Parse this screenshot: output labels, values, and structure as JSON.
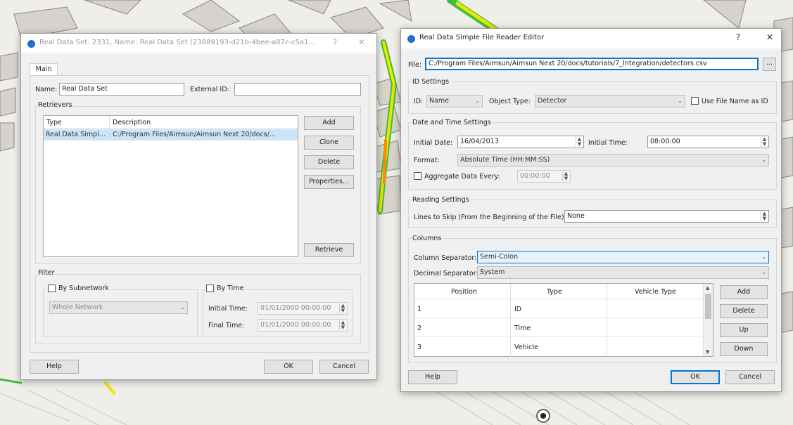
{
  "colors": {
    "accent": "#0078d7",
    "title_dot": "#1e6fd0",
    "map_bg": "#efeee9",
    "map_green": "#3cbf3c",
    "map_yellow": "#f3e300",
    "map_orange": "#ff8a00"
  },
  "real_data_set_dialog": {
    "title": "Real Data Set: 2331, Name: Real Data Set (23889193-d21b-4bee-a87c-c5a1...",
    "help_glyph": "?",
    "close_glyph": "✕",
    "tab_main": "Main",
    "name_label": "Name:",
    "name_value": "Real Data Set",
    "external_id_label": "External ID:",
    "external_id_value": "",
    "retrievers_group": "Retrievers",
    "columns": [
      "Type",
      "Description"
    ],
    "rows": [
      {
        "type": "Real Data Simpl...",
        "description": "C:/Program Files/Aimsun/Aimsun Next 20/docs/..."
      }
    ],
    "buttons": {
      "add": "Add",
      "clone": "Clone",
      "delete": "Delete",
      "properties": "Properties...",
      "retrieve": "Retrieve"
    },
    "filter_group": "Filter",
    "by_subnetwork": "By Subnetwork",
    "subnetwork_value": "Whole Network",
    "by_time": "By Time",
    "initial_time_label": "Initial Time:",
    "initial_time_value": "01/01/2000 00:00:00",
    "final_time_label": "Final Time:",
    "final_time_value": "01/01/2000 00:00:00",
    "help": "Help",
    "ok": "OK",
    "cancel": "Cancel"
  },
  "reader_editor_dialog": {
    "title": "Real Data Simple File Reader Editor",
    "help_glyph": "?",
    "close_glyph": "✕",
    "file_label": "File:",
    "file_value": "C:/Program Files/Aimsun/Aimsun Next 20/docs/tutorials/7_Integration/detectors.csv",
    "browse": "...",
    "id_settings": "ID Settings",
    "id_label": "ID:",
    "id_value": "Name",
    "object_type_label": "Object Type:",
    "object_type_value": "Detector",
    "use_file_name": "Use File Name as ID",
    "date_time_settings": "Date and Time Settings",
    "initial_date_label": "Initial Date:",
    "initial_date_value": "16/04/2013",
    "initial_time_label": "Initial Time:",
    "initial_time_value": "08:00:00",
    "format_label": "Format:",
    "format_value": "Absolute Time (HH:MM:SS)",
    "aggregate_label": "Aggregate Data Every:",
    "aggregate_value": "00:00:00",
    "reading_settings": "Reading Settings",
    "lines_to_skip_label": "Lines to Skip (From the Beginning of the File):",
    "lines_to_skip_value": "None",
    "columns_group": "Columns",
    "column_separator_label": "Column Separator:",
    "column_separator_value": "Semi-Colon",
    "decimal_separator_label": "Decimal Separator:",
    "decimal_separator_value": "System",
    "table_headers": [
      "Position",
      "Type",
      "Vehicle Type"
    ],
    "table_rows": [
      {
        "position": "1",
        "type": "ID",
        "vehicle_type": ""
      },
      {
        "position": "2",
        "type": "Time",
        "vehicle_type": ""
      },
      {
        "position": "3",
        "type": "Vehicle",
        "vehicle_type": ""
      }
    ],
    "buttons": {
      "add": "Add",
      "delete": "Delete",
      "up": "Up",
      "down": "Down"
    },
    "help": "Help",
    "ok": "OK",
    "cancel": "Cancel"
  }
}
